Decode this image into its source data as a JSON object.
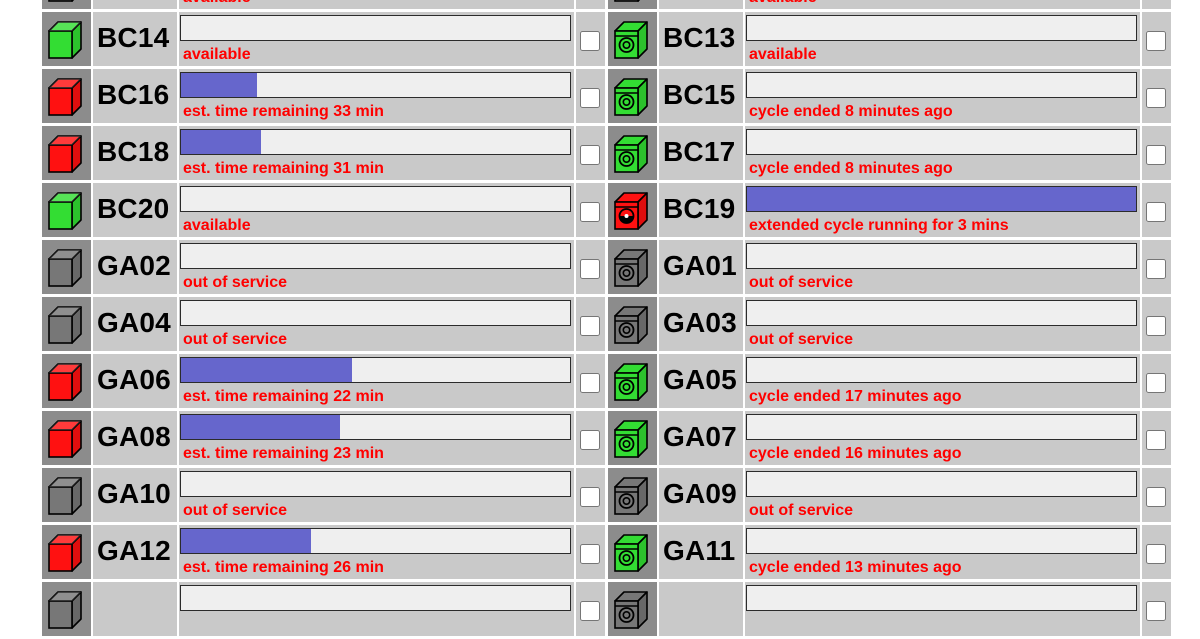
{
  "colors": {
    "available": "#33dd33",
    "running": "#ff1111",
    "offline": "#777777",
    "progress_fill": "#6666cc",
    "status_text": "#ff0000"
  },
  "left_column": [
    {
      "name": "",
      "icon": "washer-offline-icon",
      "type": "washer",
      "state": "offline",
      "status": "available",
      "progress": 0
    },
    {
      "name": "BC14",
      "icon": "washer-available-icon",
      "type": "washer",
      "state": "available",
      "status": "available",
      "progress": 0
    },
    {
      "name": "BC16",
      "icon": "washer-running-icon",
      "type": "washer",
      "state": "running",
      "status": "est. time remaining 33 min",
      "progress": 0.195
    },
    {
      "name": "BC18",
      "icon": "washer-running-icon",
      "type": "washer",
      "state": "running",
      "status": "est. time remaining 31 min",
      "progress": 0.205
    },
    {
      "name": "BC20",
      "icon": "washer-available-icon",
      "type": "washer",
      "state": "available",
      "status": "available",
      "progress": 0
    },
    {
      "name": "GA02",
      "icon": "washer-offline-icon",
      "type": "washer",
      "state": "offline",
      "status": "out of service",
      "progress": 0
    },
    {
      "name": "GA04",
      "icon": "washer-offline-icon",
      "type": "washer",
      "state": "offline",
      "status": "out of service",
      "progress": 0
    },
    {
      "name": "GA06",
      "icon": "washer-running-icon",
      "type": "washer",
      "state": "running",
      "status": "est. time remaining 22 min",
      "progress": 0.44
    },
    {
      "name": "GA08",
      "icon": "washer-running-icon",
      "type": "washer",
      "state": "running",
      "status": "est. time remaining 23 min",
      "progress": 0.41
    },
    {
      "name": "GA10",
      "icon": "washer-offline-icon",
      "type": "washer",
      "state": "offline",
      "status": "out of service",
      "progress": 0
    },
    {
      "name": "GA12",
      "icon": "washer-running-icon",
      "type": "washer",
      "state": "running",
      "status": "est. time remaining 26 min",
      "progress": 0.335
    },
    {
      "name": "",
      "icon": "washer-offline-icon",
      "type": "washer",
      "state": "offline",
      "status": "",
      "progress": 0
    }
  ],
  "right_column": [
    {
      "name": "",
      "icon": "dryer-offline-icon",
      "type": "dryer",
      "state": "offline",
      "status": "available",
      "progress": 0
    },
    {
      "name": "BC13",
      "icon": "dryer-available-icon",
      "type": "dryer",
      "state": "available",
      "status": "available",
      "progress": 0
    },
    {
      "name": "BC15",
      "icon": "dryer-available-icon",
      "type": "dryer",
      "state": "available",
      "status": "cycle ended 8 minutes ago",
      "progress": 0
    },
    {
      "name": "BC17",
      "icon": "dryer-available-icon",
      "type": "dryer",
      "state": "available",
      "status": "cycle ended 8 minutes ago",
      "progress": 0
    },
    {
      "name": "BC19",
      "icon": "dryer-running-icon",
      "type": "dryer",
      "state": "running",
      "status": "extended cycle running for 3 mins",
      "progress": 1
    },
    {
      "name": "GA01",
      "icon": "dryer-offline-icon",
      "type": "dryer",
      "state": "offline",
      "status": "out of service",
      "progress": 0
    },
    {
      "name": "GA03",
      "icon": "dryer-offline-icon",
      "type": "dryer",
      "state": "offline",
      "status": "out of service",
      "progress": 0
    },
    {
      "name": "GA05",
      "icon": "dryer-available-icon",
      "type": "dryer",
      "state": "available",
      "status": "cycle ended 17 minutes ago",
      "progress": 0
    },
    {
      "name": "GA07",
      "icon": "dryer-available-icon",
      "type": "dryer",
      "state": "available",
      "status": "cycle ended 16 minutes ago",
      "progress": 0
    },
    {
      "name": "GA09",
      "icon": "dryer-offline-icon",
      "type": "dryer",
      "state": "offline",
      "status": "out of service",
      "progress": 0
    },
    {
      "name": "GA11",
      "icon": "dryer-available-icon",
      "type": "dryer",
      "state": "available",
      "status": "cycle ended 13 minutes ago",
      "progress": 0
    },
    {
      "name": "",
      "icon": "dryer-offline-icon",
      "type": "dryer",
      "state": "offline",
      "status": "",
      "progress": 0
    }
  ]
}
